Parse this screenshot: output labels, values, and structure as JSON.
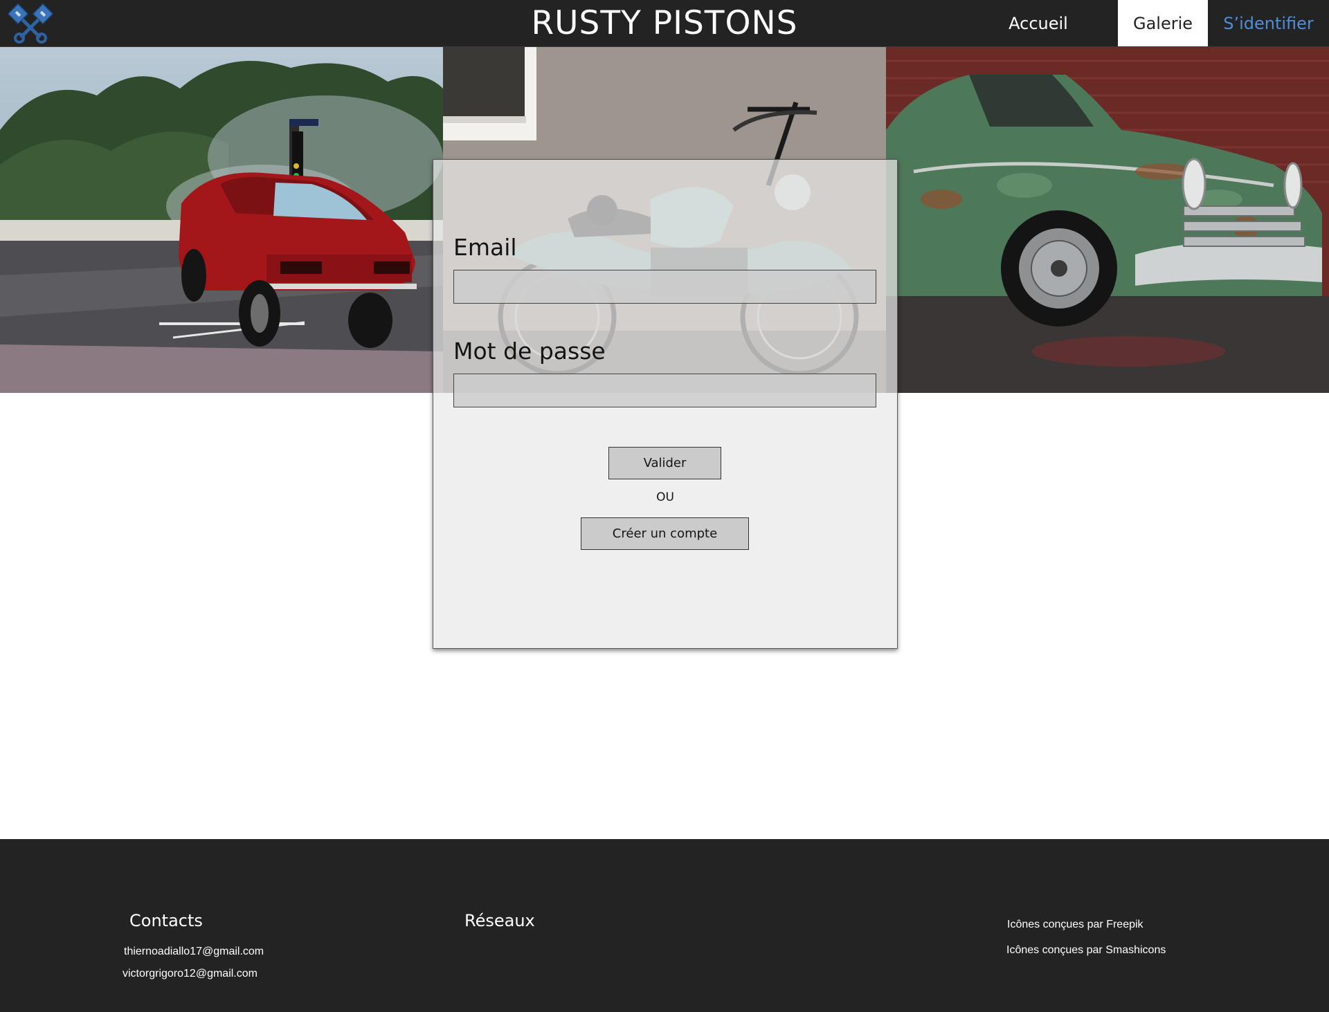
{
  "header": {
    "title": "RUSTY PISTONS",
    "logo_icon": "crossed-pistons-icon",
    "nav": {
      "home": "Accueil",
      "gallery": "Galerie",
      "login": "S’identifier"
    },
    "colors": {
      "background": "#232323",
      "active_tab": "#ffffff",
      "login_link": "#4f8fd3"
    }
  },
  "hero": {
    "images": [
      "red-muscle-car-drag-race",
      "vintage-motorcycle-against-wall",
      "rusty-green-classic-car"
    ]
  },
  "login": {
    "email_label": "Email",
    "email_value": "",
    "password_label": "Mot de passe",
    "password_value": "",
    "submit_label": "Valider",
    "separator": "OU",
    "create_label": "Créer un compte"
  },
  "footer": {
    "contacts_title": "Contacts",
    "emails": [
      "thiernoadiallo17@gmail.com",
      "victorgrigoro12@gmail.com"
    ],
    "networks_title": "Réseaux",
    "credits": [
      "Icônes conçues par Freepik",
      "Icônes conçues par Smashicons"
    ]
  }
}
